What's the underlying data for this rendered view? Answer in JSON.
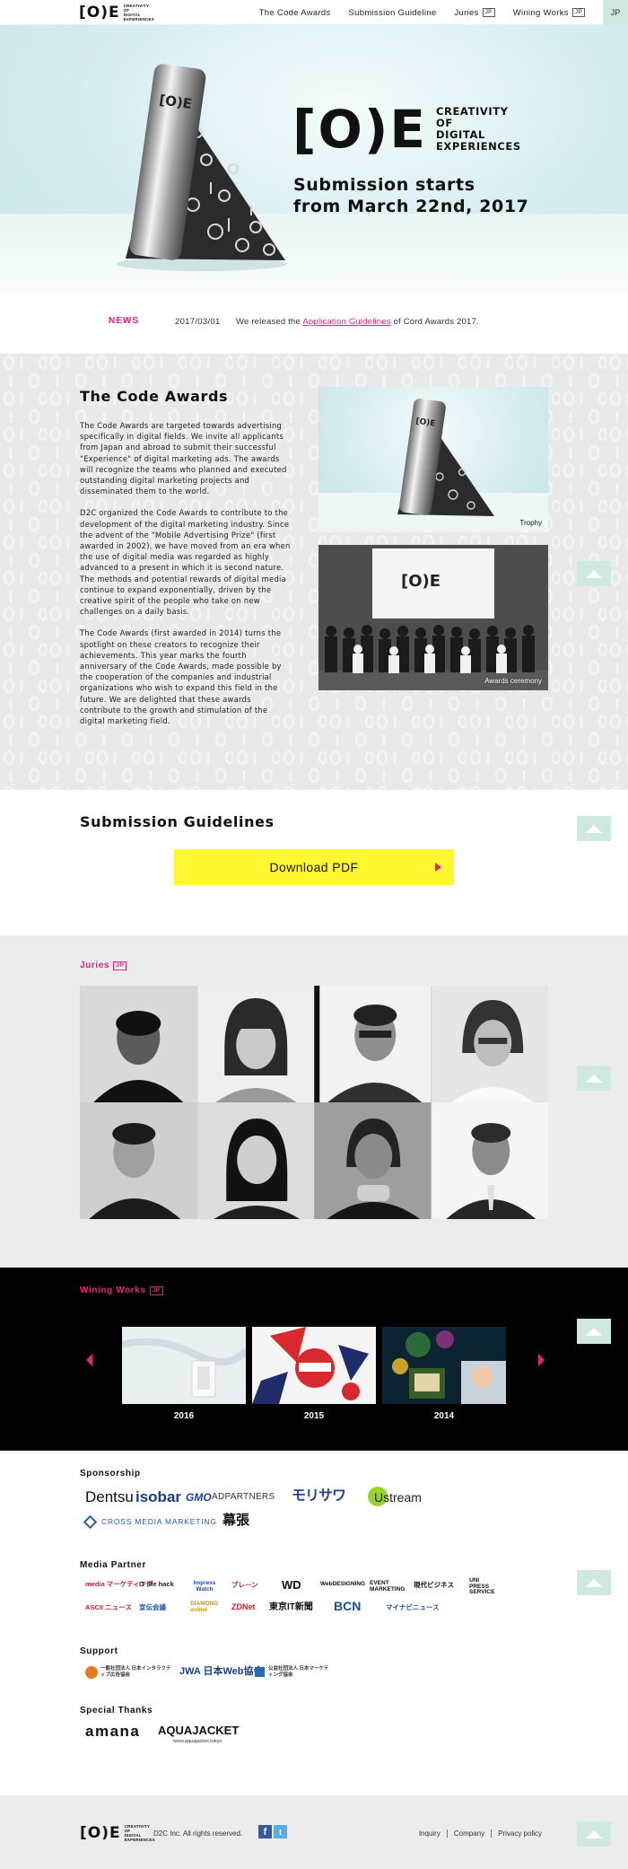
{
  "header": {
    "logo_mark": "[O)E",
    "logo_sub": [
      "CREATIVITY",
      "OF",
      "DIGITAL",
      "EXPERIENCES"
    ],
    "nav": [
      {
        "label": "The Code Awards"
      },
      {
        "label": "Submission Guideline"
      },
      {
        "label": "Juries",
        "tag": "JP"
      },
      {
        "label": "Wining Works",
        "tag": "JP"
      }
    ],
    "lang": "JP"
  },
  "hero": {
    "logo_mark": "[O)E",
    "logo_sub": [
      "CREATIVITY",
      "OF",
      "DIGITAL",
      "EXPERIENCES"
    ],
    "title_line1": "Submission starts",
    "title_line2": "from March 22nd, 2017"
  },
  "news": {
    "label": "NEWS",
    "date": "2017/03/01",
    "text_before": "We released the ",
    "link": "Application Guidelines",
    "text_after": " of Cord Awards 2017."
  },
  "about": {
    "title": "The Code Awards",
    "paragraphs": [
      "The Code Awards are targeted towards advertising specifically in digital fields. We invite all applicants from Japan and abroad to submit their successful \"Experience\" of digital marketing ads. The awards will recognize the teams who planned and executed outstanding digital marketing projects and disseminated them to the world.",
      "D2C organized the Code Awards to contribute to the development of the digital marketing industry. Since the advent of the \"Mobile Advertising Prize\" (first awarded in 2002), we have moved from an era when the use of digital media was regarded as highly advanced to a present in which it is second nature. The methods and potential rewards of digital media continue to expand exponentially, driven by the creative spirit of the people who take on new challenges on a daily basis.",
      "The Code Awards (first awarded in 2014) turns the spotlight on these creators to recognize their achievements. This year marks the fourth anniversary of the Code Awards, made possible by the cooperation of the companies and industrial organizations who wish to expand this field in the future. We are delighted that these awards contribute to the growth and stimulation of the digital marketing field."
    ],
    "photo_trophy_caption": "Trophy",
    "photo_ceremony_caption": "Awards ceremony",
    "screen_logo": "[O)E"
  },
  "guidelines": {
    "title": "Submission Guidelines",
    "button": "Download PDF"
  },
  "juries": {
    "label": "Juries",
    "tag": "JP"
  },
  "works": {
    "label": "Wining Works",
    "tag": "JP",
    "items": [
      {
        "year": "2016"
      },
      {
        "year": "2015"
      },
      {
        "year": "2014"
      }
    ]
  },
  "sponsors": {
    "sponsorship_heading": "Sponsorship",
    "sponsorship": [
      "Dentsu",
      "isobar",
      "GMO",
      "ADPARTNERS",
      "モリサワ",
      "Ustream",
      "CROSS MEDIA MARKETING",
      "幕張"
    ],
    "media_heading": "Media Partner",
    "media": [
      "media マーケティング",
      "IT life hack",
      "Impress Watch",
      "ブレーン",
      "WD",
      "WebDESIGNING",
      "EVENT MARKETING",
      "現代ビジネス",
      "UNI PRESS SERVICE",
      "ASCII ニュース",
      "宣伝会議",
      "DIAMOND online",
      "ZDNet",
      "東京IT新聞",
      "BCN",
      "マイナビニュース"
    ],
    "support_heading": "Support",
    "support": [
      "一般社団法人 日本インタラクティブ広告協会",
      "JWA 日本Web協会",
      "公益社団法人 日本マーケティング協会"
    ],
    "thanks_heading": "Special Thanks",
    "thanks": [
      "amana",
      "AQUAJACKET",
      "www.aquajacket.tokyo"
    ]
  },
  "footer": {
    "logo_mark": "[O)E",
    "copyright": "D2C Inc. All rights reserved.",
    "links": [
      "Inquiry",
      "Company",
      "Privacy policy"
    ]
  },
  "colors": {
    "accent": "#e3227b",
    "mint": "#cfe8e1",
    "yellow": "#fff730"
  }
}
